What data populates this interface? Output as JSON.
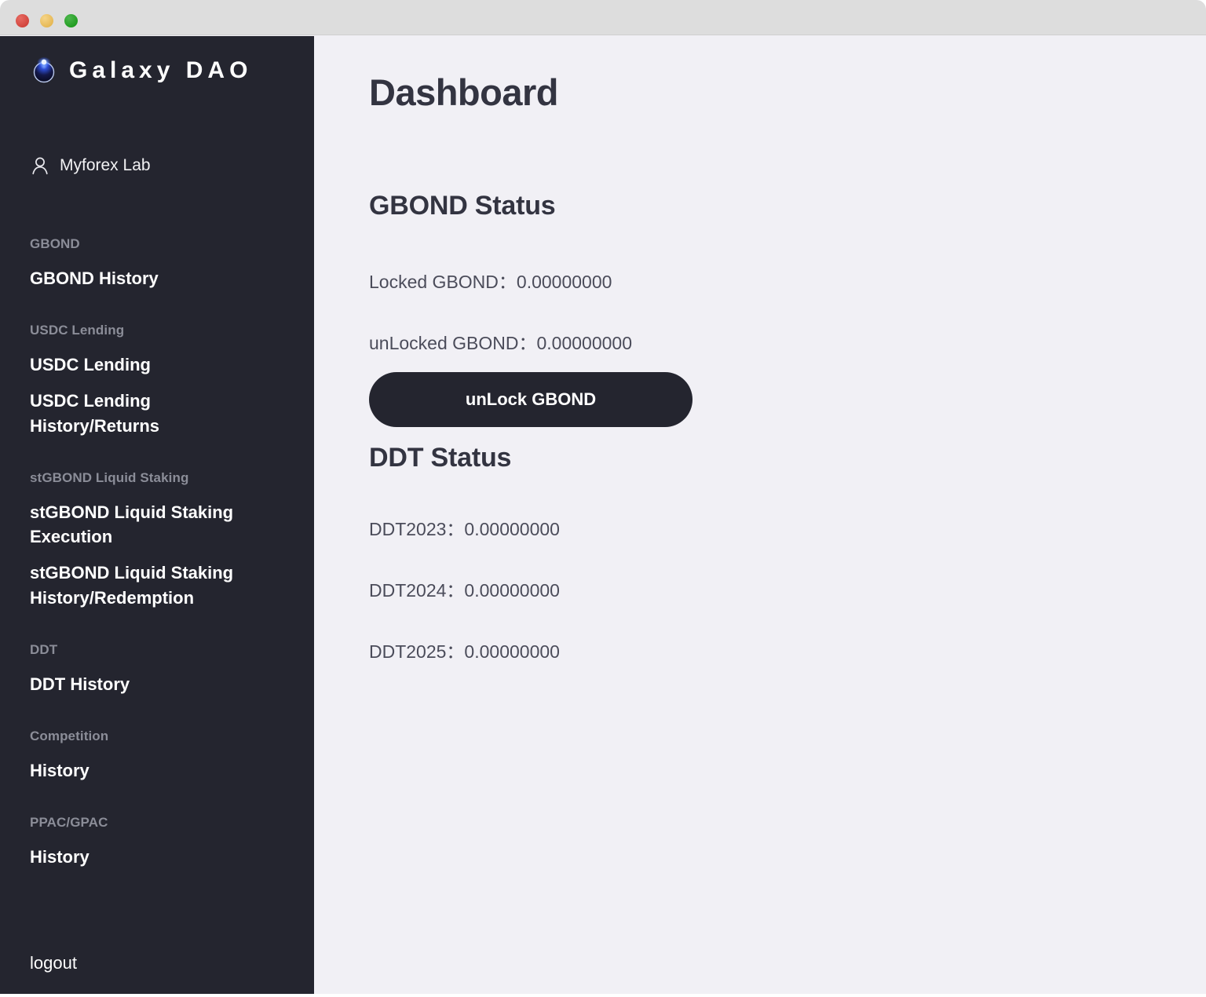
{
  "window": {
    "controls": {
      "close": "close-button",
      "minimize": "minimize-button",
      "maximize": "maximize-button"
    }
  },
  "sidebar": {
    "brand": {
      "name": "Galaxy DAO",
      "logo_icon": "galaxy-sphere-icon"
    },
    "user": {
      "name": "Myforex Lab",
      "icon": "user-icon"
    },
    "sections": [
      {
        "heading": "GBOND",
        "links": [
          "GBOND History"
        ]
      },
      {
        "heading": "USDC Lending",
        "links": [
          "USDC Lending",
          "USDC Lending History/Returns"
        ]
      },
      {
        "heading": "stGBOND Liquid Staking",
        "links": [
          "stGBOND Liquid Staking Execution",
          "stGBOND Liquid Staking History/Redemption"
        ]
      },
      {
        "heading": "DDT",
        "links": [
          "DDT History"
        ]
      },
      {
        "heading": "Competition",
        "links": [
          "History"
        ]
      },
      {
        "heading": "PPAC/GPAC",
        "links": [
          "History"
        ]
      }
    ],
    "logout_label": "logout"
  },
  "main": {
    "page_title": "Dashboard",
    "gbond": {
      "section_title": "GBOND Status",
      "locked_label": "Locked GBOND",
      "locked_value": "0.00000000",
      "unlocked_label": "unLocked GBOND",
      "unlocked_value": "0.00000000",
      "locked_line": "Locked GBOND：0.00000000",
      "unlocked_line": "unLocked GBOND：0.00000000",
      "unlock_button_label": "unLock GBOND"
    },
    "ddt": {
      "section_title": "DDT Status",
      "rows": [
        {
          "label": "DDT2023",
          "value": "0.00000000",
          "line": "DDT2023：0.00000000"
        },
        {
          "label": "DDT2024",
          "value": "0.00000000",
          "line": "DDT2024：0.00000000"
        },
        {
          "label": "DDT2025",
          "value": "0.00000000",
          "line": "DDT2025：0.00000000"
        }
      ]
    }
  },
  "colors": {
    "sidebar_bg": "#24252f",
    "main_bg": "#f1f0f5",
    "titlebar_bg": "#dddddd",
    "heading_text": "#333441",
    "body_text": "#4b4c5a",
    "muted_text": "#8b8d98",
    "accent_logo": "#2b3bd8"
  }
}
